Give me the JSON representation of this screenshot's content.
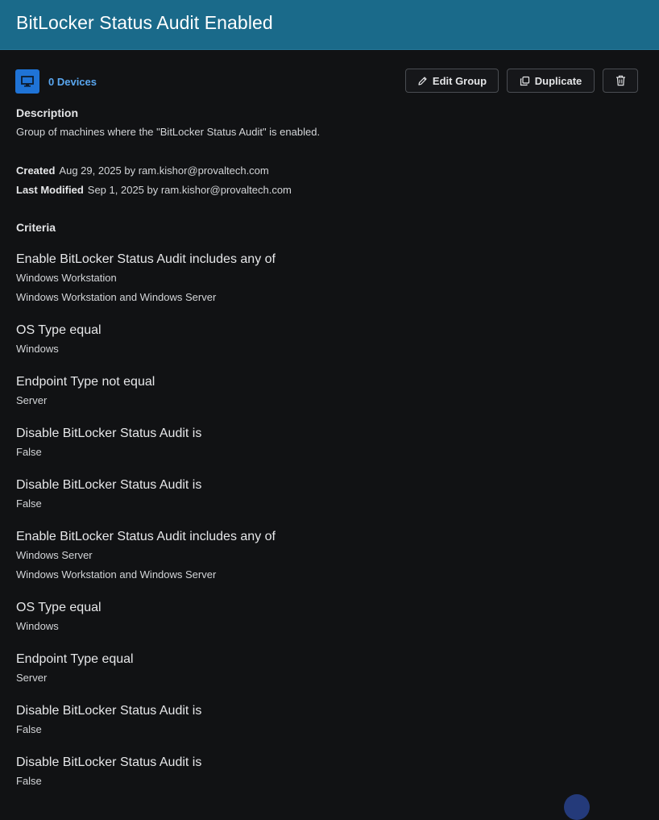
{
  "header": {
    "title": "BitLocker Status Audit Enabled"
  },
  "devices": {
    "label": "0 Devices",
    "icon": "monitor-icon"
  },
  "toolbar": {
    "edit_label": "Edit Group",
    "duplicate_label": "Duplicate",
    "delete_icon": "trash-icon"
  },
  "description": {
    "heading": "Description",
    "text": "Group of machines where the \"BitLocker Status Audit\" is enabled."
  },
  "meta": {
    "created_label": "Created",
    "created_value": "Aug 29, 2025 by ram.kishor@provaltech.com",
    "modified_label": "Last Modified",
    "modified_value": "Sep 1, 2025 by ram.kishor@provaltech.com"
  },
  "criteria": {
    "heading": "Criteria",
    "items": [
      {
        "title": "Enable BitLocker Status Audit includes any of",
        "values": [
          "Windows Workstation",
          "Windows Workstation and Windows Server"
        ]
      },
      {
        "title": "OS Type equal",
        "values": [
          "Windows"
        ]
      },
      {
        "title": "Endpoint Type not equal",
        "values": [
          "Server"
        ]
      },
      {
        "title": "Disable BitLocker Status Audit is",
        "values": [
          "False"
        ]
      },
      {
        "title": "Disable BitLocker Status Audit is",
        "values": [
          "False"
        ]
      },
      {
        "title": "Enable BitLocker Status Audit includes any of",
        "values": [
          "Windows Server",
          "Windows Workstation and Windows Server"
        ]
      },
      {
        "title": "OS Type equal",
        "values": [
          "Windows"
        ]
      },
      {
        "title": "Endpoint Type equal",
        "values": [
          "Server"
        ]
      },
      {
        "title": "Disable BitLocker Status Audit is",
        "values": [
          "False"
        ]
      },
      {
        "title": "Disable BitLocker Status Audit is",
        "values": [
          "False"
        ]
      }
    ]
  },
  "colors": {
    "header_bg": "#1a6a8a",
    "page_bg": "#111214",
    "link": "#5aa7f0",
    "device_icon_bg": "#1f73d6"
  }
}
